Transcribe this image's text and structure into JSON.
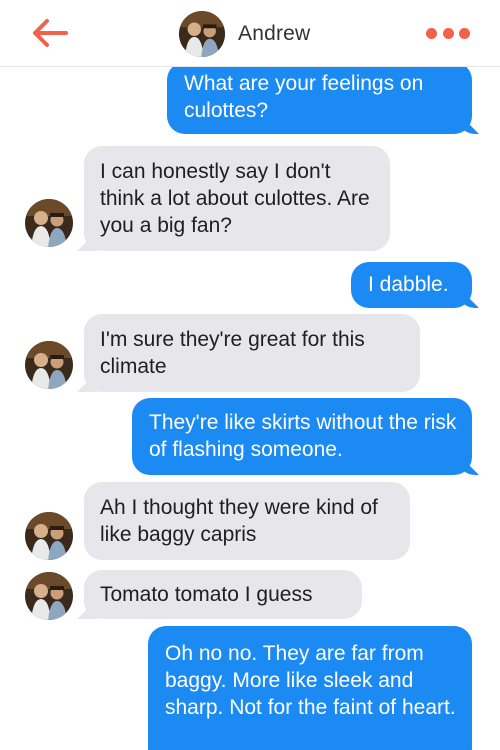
{
  "header": {
    "contact_name": "Andrew",
    "accent_color": "#f2624a",
    "back_icon": "arrow-left-icon",
    "more_icon": "ellipsis-icon"
  },
  "colors": {
    "outgoing_bubble": "#1b8af3",
    "incoming_bubble": "#e6e6eb"
  },
  "messages": [
    {
      "from": "me",
      "text": "What are your feelings on culottes?"
    },
    {
      "from": "Andrew",
      "text": "I can honestly say I don't think a lot about culottes. Are you a big fan?"
    },
    {
      "from": "me",
      "text": "I dabble."
    },
    {
      "from": "Andrew",
      "text": "I'm sure they're great for this climate"
    },
    {
      "from": "me",
      "text": "They're like skirts without the risk of flashing someone."
    },
    {
      "from": "Andrew",
      "text": "Ah I thought they were kind of like baggy capris"
    },
    {
      "from": "Andrew",
      "text": "Tomato tomato I guess"
    },
    {
      "from": "me",
      "text": "Oh no no. They are far from baggy. More like sleek and sharp. Not for the faint of heart."
    }
  ]
}
